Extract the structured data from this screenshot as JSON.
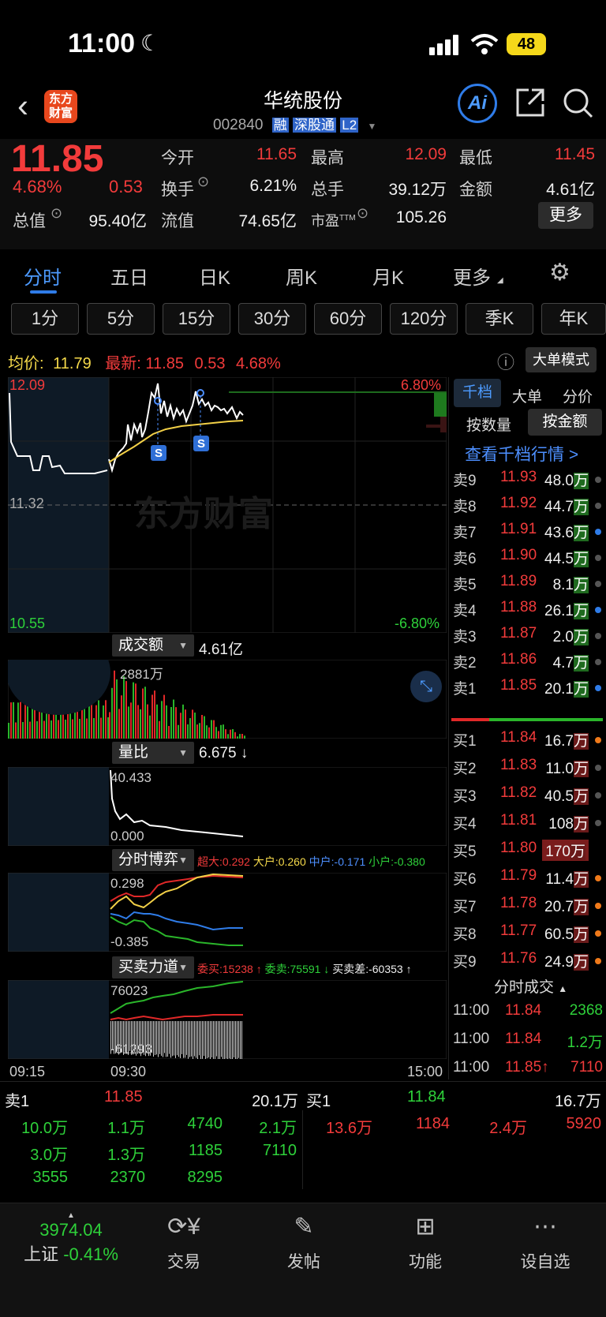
{
  "status_bar": {
    "time": "11:00",
    "battery": "48"
  },
  "nav": {
    "logo_line1": "东方",
    "logo_line2": "财富",
    "stock_name": "华统股份",
    "stock_code": "002840",
    "badges": [
      "融",
      "深股通",
      "L2"
    ],
    "ai_label": "Ai"
  },
  "quote": {
    "price": "11.85",
    "change_pct": "4.68%",
    "change": "0.53",
    "open_label": "今开",
    "open": "11.65",
    "high_label": "最高",
    "high": "12.09",
    "low_label": "最低",
    "low": "11.45",
    "turnover_label": "换手",
    "turnover": "6.21%",
    "volume_label": "总手",
    "volume": "39.12万",
    "amount_label": "金额",
    "amount": "4.61亿",
    "mcap_label": "总值",
    "mcap": "95.40亿",
    "float_label": "流值",
    "float": "74.65亿",
    "pe_label": "市盈",
    "pe_sup": "TTM",
    "pe": "105.26",
    "more_label": "更多"
  },
  "tabs": [
    "分时",
    "五日",
    "日K",
    "周K",
    "月K",
    "更多"
  ],
  "periods": [
    "1分",
    "5分",
    "15分",
    "30分",
    "60分",
    "120分",
    "季K",
    "年K"
  ],
  "info_line": {
    "avg_label": "均价:",
    "avg": "11.79",
    "latest_label": "最新:",
    "latest": "11.85",
    "chg": "0.53",
    "pct": "4.68%",
    "big_order_mode": "大单模式"
  },
  "main_chart": {
    "y_top": "12.09",
    "y_mid": "11.32",
    "y_bot": "10.55",
    "pct_top": "6.80%",
    "pct_bot": "-6.80%",
    "watermark": "东方财富",
    "marker": "S"
  },
  "amount_panel": {
    "label": "成交额",
    "value": "4.61亿",
    "max_label": "2881万"
  },
  "ratio_panel": {
    "label": "量比",
    "value": "6.675 ↓",
    "max_label": "40.433",
    "min_label": "0.000"
  },
  "game_panel": {
    "label": "分时博弈",
    "super": "超大:0.292",
    "big": "大户:0.260",
    "mid": "中户:-0.171",
    "small": "小户:-0.380",
    "max_label": "0.298",
    "min_label": "-0.385"
  },
  "force_panel": {
    "label": "买卖力道",
    "buy": "委买:15238 ↑",
    "sell": "委卖:75591 ↓",
    "diff": "买卖差:-60353 ↑",
    "max_label": "76023",
    "min_label": "-61293"
  },
  "time_axis": [
    "09:15",
    "09:30",
    "15:00"
  ],
  "orderbook": {
    "tabs": [
      "千档",
      "大单",
      "分价"
    ],
    "sort": [
      "按数量",
      "按金额"
    ],
    "link": "查看千档行情 >",
    "sells": [
      {
        "label": "卖9",
        "price": "11.93",
        "vol": "48.0",
        "unit": "万",
        "dot": "gray"
      },
      {
        "label": "卖8",
        "price": "11.92",
        "vol": "44.7",
        "unit": "万",
        "dot": "gray"
      },
      {
        "label": "卖7",
        "price": "11.91",
        "vol": "43.6",
        "unit": "万",
        "dot": "blue"
      },
      {
        "label": "卖6",
        "price": "11.90",
        "vol": "44.5",
        "unit": "万",
        "dot": "gray"
      },
      {
        "label": "卖5",
        "price": "11.89",
        "vol": "8.1",
        "unit": "万",
        "dot": "gray"
      },
      {
        "label": "卖4",
        "price": "11.88",
        "vol": "26.1",
        "unit": "万",
        "dot": "blue"
      },
      {
        "label": "卖3",
        "price": "11.87",
        "vol": "2.0",
        "unit": "万",
        "dot": "gray"
      },
      {
        "label": "卖2",
        "price": "11.86",
        "vol": "4.7",
        "unit": "万",
        "dot": "gray"
      },
      {
        "label": "卖1",
        "price": "11.85",
        "vol": "20.1",
        "unit": "万",
        "dot": "blue"
      }
    ],
    "buys": [
      {
        "label": "买1",
        "price": "11.84",
        "vol": "16.7",
        "unit": "万",
        "dot": "orange"
      },
      {
        "label": "买2",
        "price": "11.83",
        "vol": "11.0",
        "unit": "万",
        "dot": "gray"
      },
      {
        "label": "买3",
        "price": "11.82",
        "vol": "40.5",
        "unit": "万",
        "dot": "gray"
      },
      {
        "label": "买4",
        "price": "11.81",
        "vol": "108",
        "unit": "万",
        "dot": "gray"
      },
      {
        "label": "买5",
        "price": "11.80",
        "vol": "170",
        "unit": "万",
        "dot": "none"
      },
      {
        "label": "买6",
        "price": "11.79",
        "vol": "11.4",
        "unit": "万",
        "dot": "orange"
      },
      {
        "label": "买7",
        "price": "11.78",
        "vol": "20.7",
        "unit": "万",
        "dot": "orange"
      },
      {
        "label": "买8",
        "price": "11.77",
        "vol": "60.5",
        "unit": "万",
        "dot": "orange"
      },
      {
        "label": "买9",
        "price": "11.76",
        "vol": "24.9",
        "unit": "万",
        "dot": "orange"
      }
    ],
    "ticks_title": "分时成交",
    "ticks": [
      {
        "time": "11:00",
        "price": "11.84",
        "vol": "2368"
      },
      {
        "time": "11:00",
        "price": "11.84",
        "vol": "1.2万"
      },
      {
        "time": "11:00",
        "price": "11.85↑",
        "vol": "7110"
      }
    ]
  },
  "queue": {
    "sell_label": "卖1",
    "sell_price": "11.85",
    "sell_vol": "20.1万",
    "buy_label": "买1",
    "buy_price": "11.84",
    "buy_vol": "16.7万",
    "sell_rows": [
      [
        "10.0万",
        "1.1万",
        "4740",
        "2.1万"
      ],
      [
        "3.0万",
        "1.3万",
        "1185",
        "7110"
      ],
      [
        "3555",
        "2370",
        "8295",
        ""
      ]
    ],
    "buy_rows": [
      [
        "13.6万",
        "1184",
        "2.4万",
        "5920"
      ]
    ]
  },
  "bottom_nav": {
    "index_value": "3974.04",
    "index_name": "上证",
    "index_change": "-0.41%",
    "items": [
      "交易",
      "发帖",
      "功能",
      "设自选"
    ]
  }
}
